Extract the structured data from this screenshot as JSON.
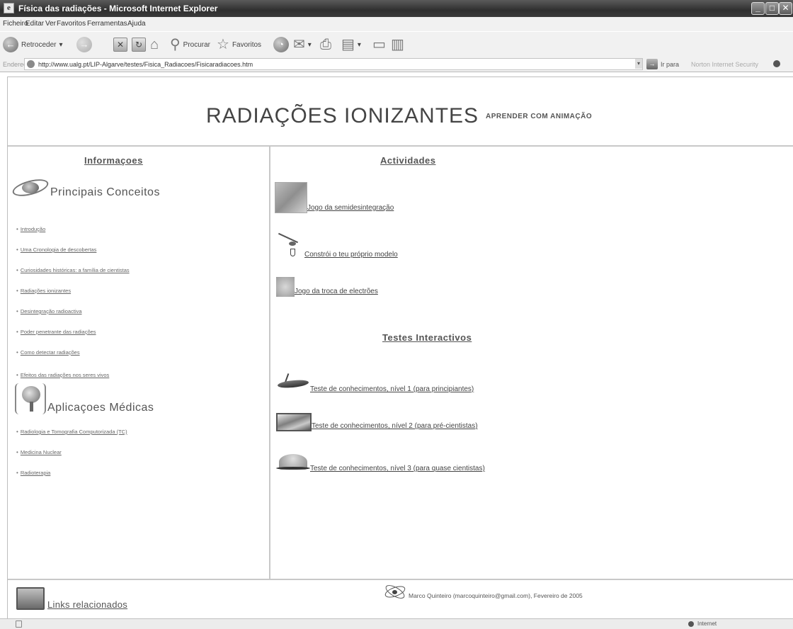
{
  "window": {
    "title": "Física das radiações - Microsoft Internet Explorer",
    "minimize": "_",
    "maximize": "□",
    "close": "✕"
  },
  "menubar": [
    "Ficheiro",
    "Editar",
    "Ver",
    "Favoritos",
    "Ferramentas",
    "Ajuda"
  ],
  "toolbar": {
    "back_label": "Retroceder",
    "search_label": "Procurar",
    "favorites_label": "Favoritos"
  },
  "addressbar": {
    "label": "Endereço",
    "url": "http://www.ualg.pt/LIP-Algarve/testes/Fisica_Radiacoes/Fisicaradiacoes.htm",
    "go_label": "Ir para",
    "links_label": "Norton Internet Security"
  },
  "page": {
    "title": "RADIAÇÕES IONIZANTES",
    "subtitle": "APRENDER COM ANIMAÇÃO"
  },
  "left": {
    "heading": "Informaçoes",
    "section1": {
      "title": "Principais Conceitos",
      "links": [
        "Introdução",
        "Uma Cronologia de descobertas",
        "Curiosidades históricas: a família de cientistas",
        "Radiações ionizantes",
        "Desintegração radioactiva",
        "Poder penetrante das radiações",
        "Como detectar radiações",
        "Efeitos das radiações nos seres vivos"
      ]
    },
    "section2": {
      "title": "Aplicaçoes Médicas",
      "links": [
        "Radiologia e Tomografia Computorizada (TC)",
        "Medicina Nuclear",
        "Radioterapia"
      ]
    }
  },
  "right": {
    "activities_heading": "Actividades",
    "activities": [
      "Jogo da semidesintegração",
      "Constrói o teu próprio modelo",
      "Jogo da troca de electrões"
    ],
    "tests_heading": "Testes Interactivos",
    "tests": [
      "Teste de conhecimentos, nível 1 (para principiantes)",
      "Teste de conhecimentos, nível 2 (para pré-cientistas)",
      "Teste de conhecimentos, nível 3 (para quase cientistas)"
    ]
  },
  "footer": {
    "links_label": "Links relacionados",
    "credit": "Marco Quinteiro (marcoquinteiro@gmail.com), Fevereiro de 2005"
  },
  "status": {
    "zone": "Internet"
  }
}
